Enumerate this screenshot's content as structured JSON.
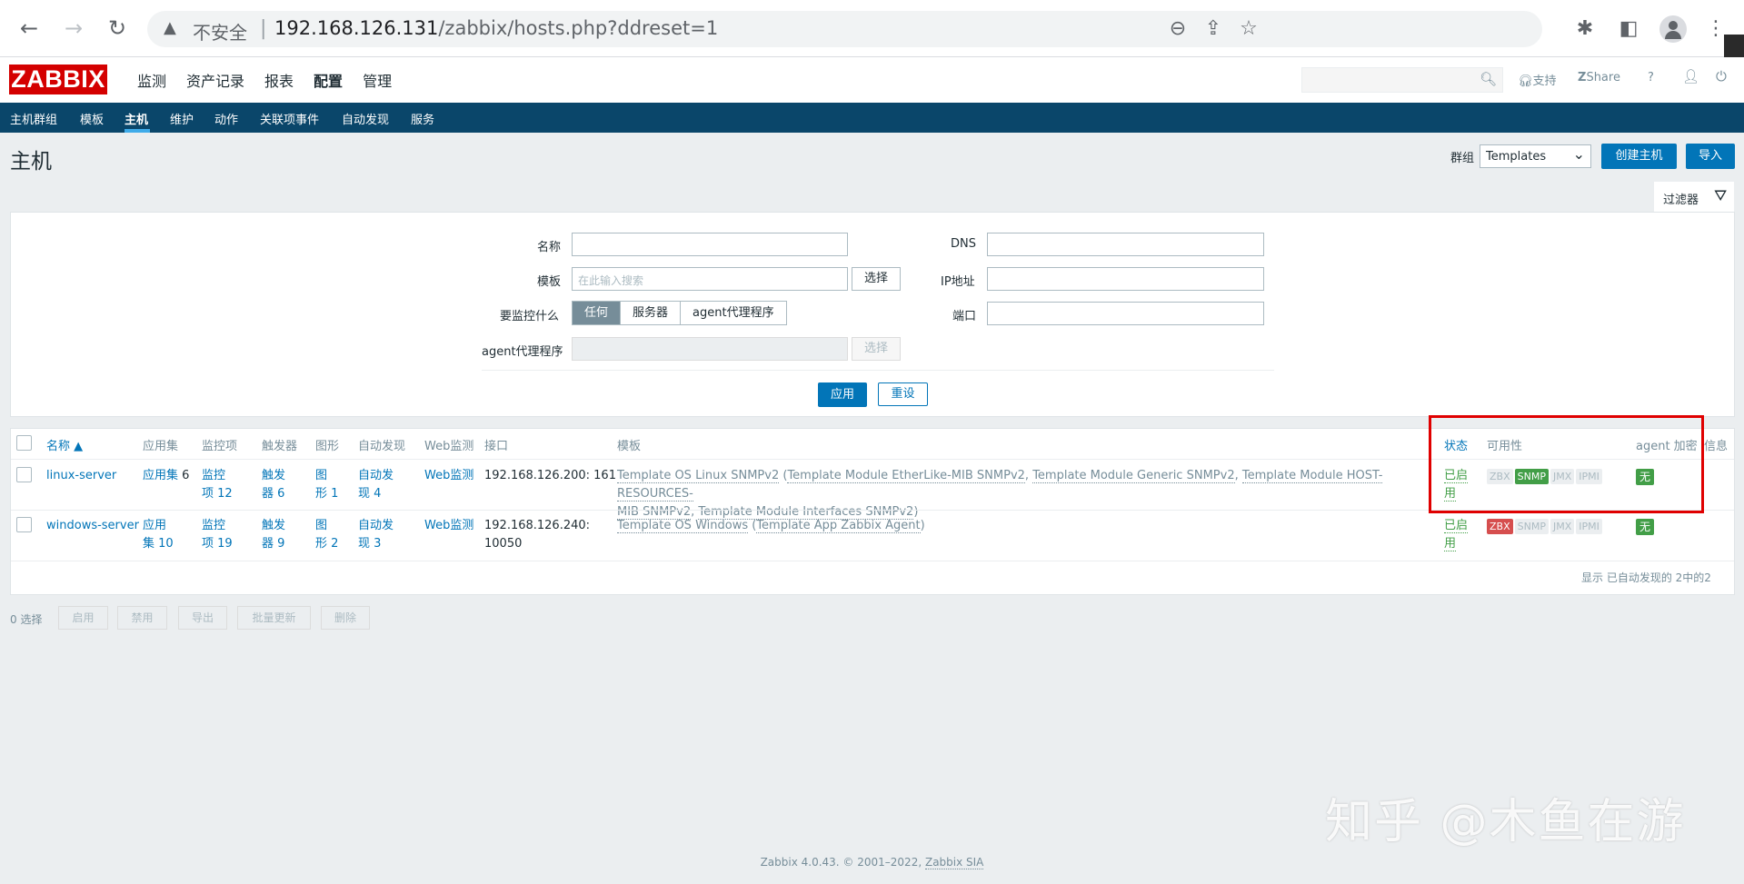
{
  "browser": {
    "insecure_label": "不安全",
    "url_host": "192.168.126.131",
    "url_path": "/zabbix/hosts.php?ddreset=1"
  },
  "header": {
    "logo": "ZABBIX",
    "menu": [
      "监测",
      "资产记录",
      "报表",
      "配置",
      "管理"
    ],
    "support": "支持",
    "share": "Share",
    "help": "?"
  },
  "subnav": {
    "items": [
      "主机群组",
      "模板",
      "主机",
      "维护",
      "动作",
      "关联项事件",
      "自动发现",
      "服务"
    ]
  },
  "page": {
    "title": "主机",
    "group_label": "群组",
    "group_value": "Templates",
    "create_button": "创建主机",
    "import_button": "导入",
    "filter_tab": "过滤器"
  },
  "filter": {
    "name_label": "名称",
    "template_label": "模板",
    "template_placeholder": "在此输入搜索",
    "select_button": "选择",
    "monitor_label": "要监控什么",
    "monitor_options": [
      "任何",
      "服务器",
      "agent代理程序"
    ],
    "proxy_label": "agent代理程序",
    "proxy_select": "选择",
    "dns_label": "DNS",
    "ip_label": "IP地址",
    "port_label": "端口",
    "apply_button": "应用",
    "reset_button": "重设"
  },
  "table": {
    "headers": {
      "name": "名称 ▲",
      "apps": "应用集",
      "items": "监控项",
      "triggers": "触发器",
      "graphs": "图形",
      "discovery": "自动发现",
      "web": "Web监测",
      "interface": "接口",
      "templates": "模板",
      "status": "状态",
      "availability": "可用性",
      "encryption": "agent 加密",
      "info": "信息"
    },
    "rows": [
      {
        "name": "linux-server",
        "apps_1": "应用集",
        "apps_2": "6",
        "items_1": "监控",
        "items_2": "项 12",
        "triggers_1": "触发",
        "triggers_2": "器 6",
        "graphs_1": "图",
        "graphs_2": "形 1",
        "discovery_1": "自动发",
        "discovery_2": "现 4",
        "web": "Web监测",
        "interface_1": "192.168.126.200: 161",
        "interface_2": "",
        "tpl_main": "Template OS Linux SNMPv2",
        "tpl_p1": "Template Module EtherLike-MIB SNMPv2",
        "tpl_p2": "Template Module Generic SNMPv2",
        "tpl_p3a": "Template Module HOST-RESOURCES-",
        "tpl_p3b": "MIB SNMPv2",
        "tpl_p4": "Template Module Interfaces SNMPv2",
        "status_1": "已启",
        "status_2": "用",
        "zbx": "ZBX",
        "snmp": "SNMP",
        "jmx": "JMX",
        "ipmi": "IPMI",
        "encryption": "无"
      },
      {
        "name": "windows-server",
        "apps_1": "应用",
        "apps_2": "集 10",
        "items_1": "监控",
        "items_2": "项 19",
        "triggers_1": "触发",
        "triggers_2": "器 9",
        "graphs_1": "图",
        "graphs_2": "形 2",
        "discovery_1": "自动发",
        "discovery_2": "现 3",
        "web": "Web监测",
        "interface_1": "192.168.126.240:",
        "interface_2": "10050",
        "tpl_main": "Template OS Windows",
        "tpl_p1": "Template App Zabbix Agent",
        "status_1": "已启",
        "status_2": "用",
        "zbx": "ZBX",
        "snmp": "SNMP",
        "jmx": "JMX",
        "ipmi": "IPMI",
        "encryption": "无"
      }
    ],
    "footer": "显示 已自动发现的 2中的2"
  },
  "actions": {
    "selected": "0 选择",
    "enable": "启用",
    "disable": "禁用",
    "export": "导出",
    "mass_update": "批量更新",
    "delete": "删除"
  },
  "watermark": "知乎 @木鱼在游",
  "footer": {
    "text": "Zabbix 4.0.43. © 2001–2022,",
    "link": "Zabbix SIA"
  }
}
